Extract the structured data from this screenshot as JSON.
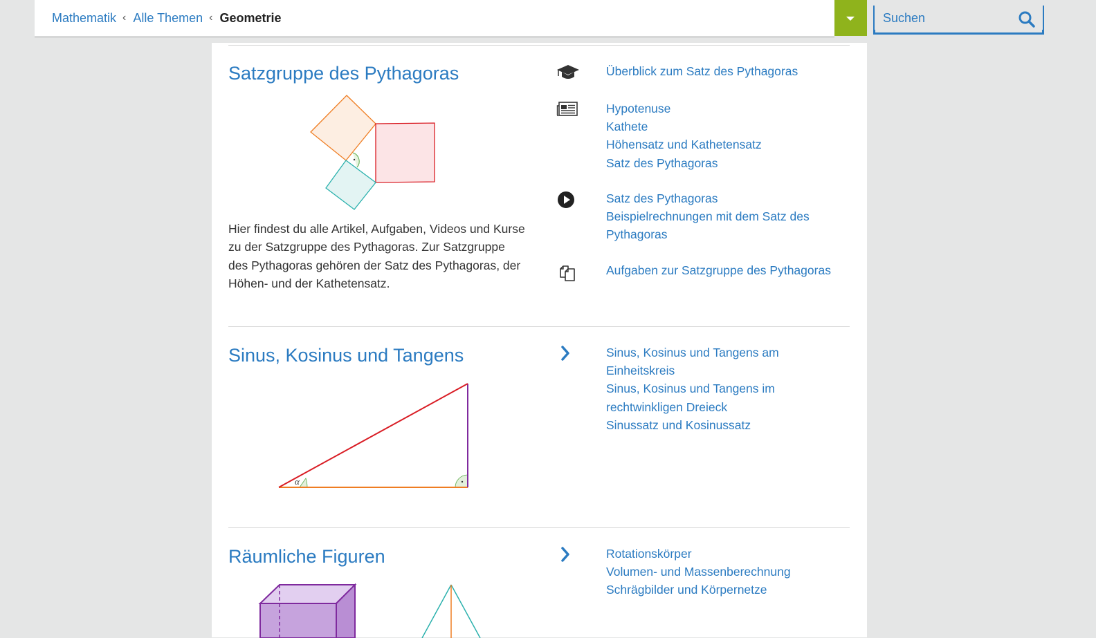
{
  "header": {
    "breadcrumb": {
      "items": [
        "Mathematik",
        "Alle Themen"
      ],
      "current": "Geometrie",
      "separator": "‹"
    },
    "dropdown_icon": "caret-down-icon",
    "search": {
      "placeholder": "Suchen",
      "icon": "search-icon"
    }
  },
  "colors": {
    "accent": "#2b7bc1",
    "brand_green": "#8fb31c",
    "background": "#e5e6e6"
  },
  "sections": [
    {
      "title": "Satzgruppe des Pythagoras",
      "description": "Hier findest du alle Artikel, Aufgaben, Videos und Kurse zu der Satzgruppe des Pythagoras. Zur Satz­gruppe des Pythagoras gehören der Satz des Pytha­goras, der Höhen- und der Kathetensatz.",
      "groups": [
        {
          "icon": "graduation-cap-icon",
          "links": [
            "Überblick zum Satz des Pythagoras"
          ]
        },
        {
          "icon": "newspaper-icon",
          "links": [
            "Hypotenuse",
            "Kathete",
            "Höhensatz und Kathetensatz",
            "Satz des Pythagoras"
          ]
        },
        {
          "icon": "play-icon",
          "links": [
            "Satz des Pythagoras",
            "Beispielrechnungen mit dem Satz des Pythagoras"
          ]
        },
        {
          "icon": "exercise-copy-icon",
          "links": [
            "Aufgaben zur Satzgruppe des Pythagoras"
          ]
        }
      ]
    },
    {
      "title": "Sinus, Kosinus und Tangens",
      "groups": [
        {
          "icon": "chevron-right-icon",
          "links": [
            "Sinus, Kosinus und Tangens am Einheitskreis",
            "Sinus, Kosinus und Tangens im rechtwinkligen Dreieck",
            "Sinussatz und Kosinussatz"
          ]
        }
      ],
      "figure_label": "α"
    },
    {
      "title": "Räumliche Figuren",
      "groups": [
        {
          "icon": "chevron-right-icon",
          "links": [
            "Rotationskörper",
            "Volumen- und Massenberechnung",
            "Schrägbilder und Körpernetze"
          ]
        }
      ]
    }
  ]
}
